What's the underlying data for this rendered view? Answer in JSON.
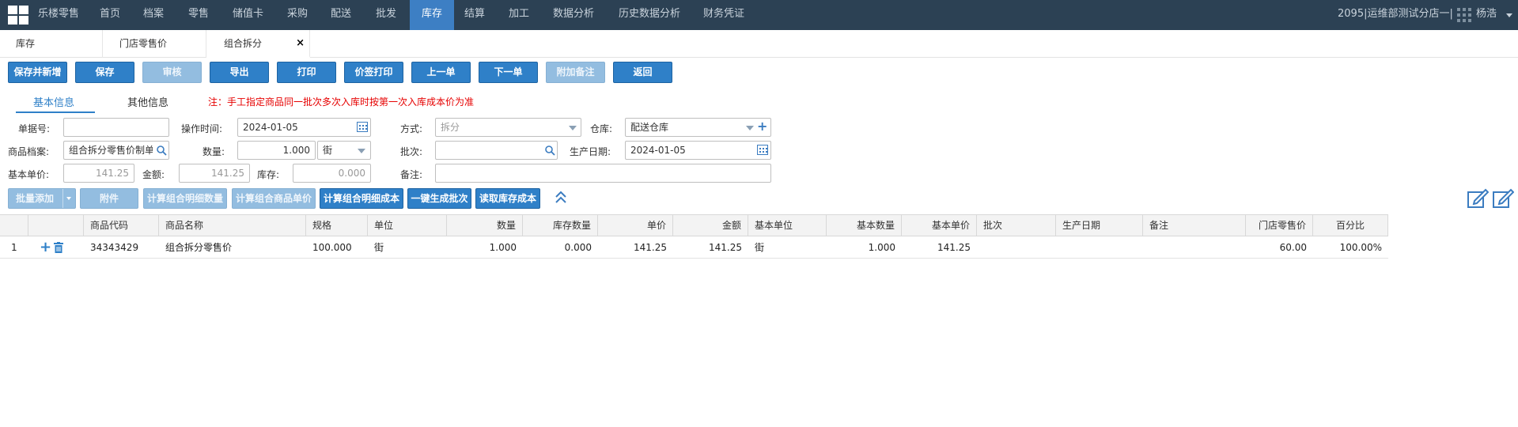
{
  "topnav": {
    "brand": "乐楼零售",
    "items": [
      "首页",
      "档案",
      "零售",
      "储值卡",
      "采购",
      "配送",
      "批发",
      "库存",
      "结算",
      "加工",
      "数据分析",
      "历史数据分析",
      "财务凭证"
    ],
    "active": "库存",
    "store": "2095|运维部测试分店一|",
    "user": "杨浩"
  },
  "page_tabs": [
    "库存",
    "门店零售价",
    "组合拆分"
  ],
  "page_tab_close": "×",
  "toolbar": [
    "保存并新增",
    "保存",
    "审核",
    "导出",
    "打印",
    "价签打印",
    "上一单",
    "下一单",
    "附加备注",
    "返回"
  ],
  "sub_tabs": [
    "基本信息",
    "其他信息"
  ],
  "note": "注：手工指定商品同一批次多次入库时按第一次入库成本价为准",
  "form": {
    "order_no_label": "单据号:",
    "order_no_value": "",
    "op_time_label": "操作时间:",
    "op_time_value": "2024-01-05",
    "method_label": "方式:",
    "method_value": "拆分",
    "warehouse_label": "仓库:",
    "warehouse_value": "配送仓库",
    "goods_label": "商品档案:",
    "goods_value": "组合拆分零售价制单",
    "qty_label": "数量:",
    "qty_value": "1.000",
    "unit_value": "街",
    "batch_label": "批次:",
    "batch_value": "",
    "prod_date_label": "生产日期:",
    "prod_date_value": "2024-01-05",
    "base_price_label": "基本单价:",
    "base_price_value": "141.25",
    "amount_label": "金额:",
    "amount_value": "141.25",
    "stock_label": "库存:",
    "stock_value": "0.000",
    "remark_label": "备注:",
    "remark_value": ""
  },
  "actions": [
    "批量添加",
    "附件",
    "计算组合明细数量",
    "计算组合商品单价",
    "计算组合明细成本",
    "一键生成批次",
    "读取库存成本"
  ],
  "table": {
    "headers": [
      "",
      "",
      "商品代码",
      "商品名称",
      "规格",
      "单位",
      "数量",
      "库存数量",
      "单价",
      "金额",
      "基本单位",
      "基本数量",
      "基本单价",
      "批次",
      "生产日期",
      "备注",
      "门店零售价",
      "百分比"
    ],
    "rows": [
      [
        "1",
        "",
        "34343429",
        "组合拆分零售价",
        "100.000",
        "街",
        "1.000",
        "0.000",
        "141.25",
        "141.25",
        "街",
        "1.000",
        "141.25",
        "",
        "",
        "",
        "60.00",
        "100.00%"
      ]
    ]
  },
  "colors": {
    "nav_bg": "#2c4154",
    "accent": "#2f80c8",
    "note": "#e60000"
  }
}
